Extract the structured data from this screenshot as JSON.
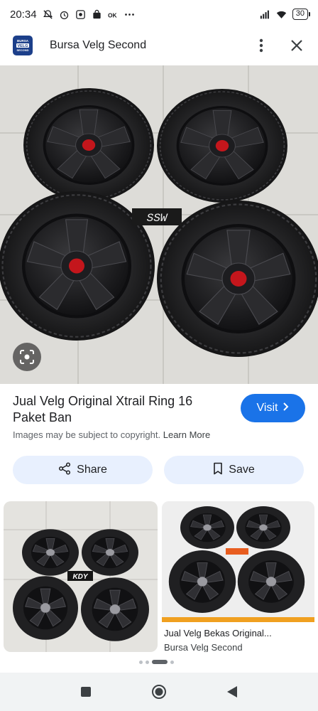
{
  "status": {
    "time": "20:34",
    "battery": "30",
    "icons": [
      "mute-icon",
      "alarm-icon",
      "photo-icon",
      "bag-icon",
      "ok-icon",
      "more-dots-icon",
      "signal-icon",
      "wifi-icon",
      "battery-icon"
    ],
    "extra": "OK"
  },
  "header": {
    "logo_text": "BURSA VELG SECOND",
    "site_name": "Bursa Velg Second",
    "icons": [
      "more-vert-icon",
      "close-icon"
    ]
  },
  "result": {
    "title": "Jual Velg Original Xtrail Ring 16 Paket Ban",
    "visit_label": "Visit",
    "copyright_text": "Images may be subject to copyright.",
    "learn_more": "Learn More",
    "hero_label": "SSW"
  },
  "actions": {
    "share_label": "Share",
    "save_label": "Save"
  },
  "related": [
    {
      "caption": "",
      "source": "",
      "badge": "KDY"
    },
    {
      "caption": "Jual Velg Bekas Original...",
      "source": "Bursa Velg Second",
      "badge": ""
    }
  ],
  "pager": {
    "count": 4,
    "active_index": 2
  },
  "colors": {
    "accent": "#1a73e8",
    "chip_bg": "#e8f0fe",
    "wheel": "#1b1b1d",
    "cap": "#c4161c"
  }
}
